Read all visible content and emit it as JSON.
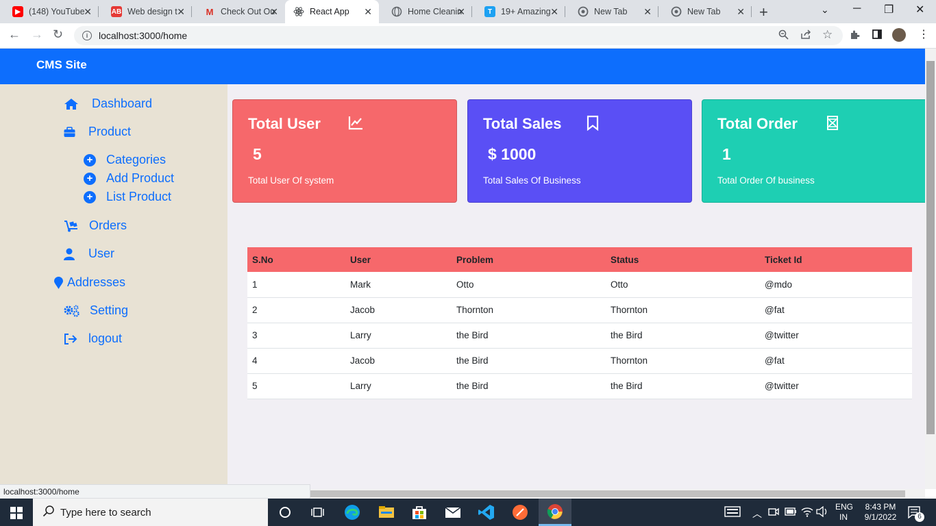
{
  "browser": {
    "tabs": [
      {
        "title": "(148) YouTube",
        "icon": "youtube-icon"
      },
      {
        "title": "Web design t",
        "icon": "web-design-icon"
      },
      {
        "title": "Check Out Ou",
        "icon": "gmail-icon"
      },
      {
        "title": "React App",
        "icon": "react-icon",
        "active": true
      },
      {
        "title": "Home Cleanin",
        "icon": "globe-icon"
      },
      {
        "title": "19+ Amazing",
        "icon": "t-icon"
      },
      {
        "title": "New Tab",
        "icon": "chrome-icon"
      },
      {
        "title": "New Tab",
        "icon": "chrome-icon"
      }
    ],
    "url": "localhost:3000/home",
    "status_url": "localhost:3000/home"
  },
  "app": {
    "brand": "CMS Site",
    "colors": {
      "topbar": "#0d6efd",
      "sidebar": "#e8e2d4",
      "link": "#0d6efd"
    }
  },
  "sidebar": {
    "items": [
      {
        "label": "Dashboard",
        "icon": "home-icon"
      },
      {
        "label": "Product",
        "icon": "briefcase-icon"
      },
      {
        "label": "Categories",
        "icon": "plus-circle-icon"
      },
      {
        "label": "Add Product",
        "icon": "plus-circle-icon"
      },
      {
        "label": "List Product",
        "icon": "plus-circle-icon"
      },
      {
        "label": "Orders",
        "icon": "cart-dolly-icon"
      },
      {
        "label": "User",
        "icon": "user-icon"
      },
      {
        "label": "Addresses",
        "icon": "map-pin-icon"
      },
      {
        "label": "Setting",
        "icon": "gears-icon"
      },
      {
        "label": "logout",
        "icon": "logout-icon"
      }
    ]
  },
  "cards": [
    {
      "title": "Total User",
      "value": "5",
      "subtitle": "Total User Of system",
      "icon": "chart-line-icon",
      "color": "#f6686b"
    },
    {
      "title": "Total Sales",
      "value": "$ 1000",
      "subtitle": "Total Sales Of Business",
      "icon": "bookmark-icon",
      "color": "#5a4ff5"
    },
    {
      "title": "Total Order",
      "value": "1",
      "subtitle": "Total Order Of business",
      "icon": "x-box-icon",
      "color": "#1ecfb3"
    }
  ],
  "table": {
    "headers": [
      "S.No",
      "User",
      "Problem",
      "Status",
      "Ticket Id"
    ],
    "header_color": "#f6686b",
    "rows": [
      [
        "1",
        "Mark",
        "Otto",
        "Otto",
        "@mdo"
      ],
      [
        "2",
        "Jacob",
        "Thornton",
        "Thornton",
        "@fat"
      ],
      [
        "3",
        "Larry",
        "the Bird",
        "the Bird",
        "@twitter"
      ],
      [
        "4",
        "Jacob",
        "the Bird",
        "Thornton",
        "@fat"
      ],
      [
        "5",
        "Larry",
        "the Bird",
        "the Bird",
        "@twitter"
      ]
    ]
  },
  "taskbar": {
    "search_placeholder": "Type here to search",
    "language": "ENG",
    "region": "IN",
    "time": "8:43 PM",
    "date": "9/1/2022",
    "notifications": "6"
  }
}
